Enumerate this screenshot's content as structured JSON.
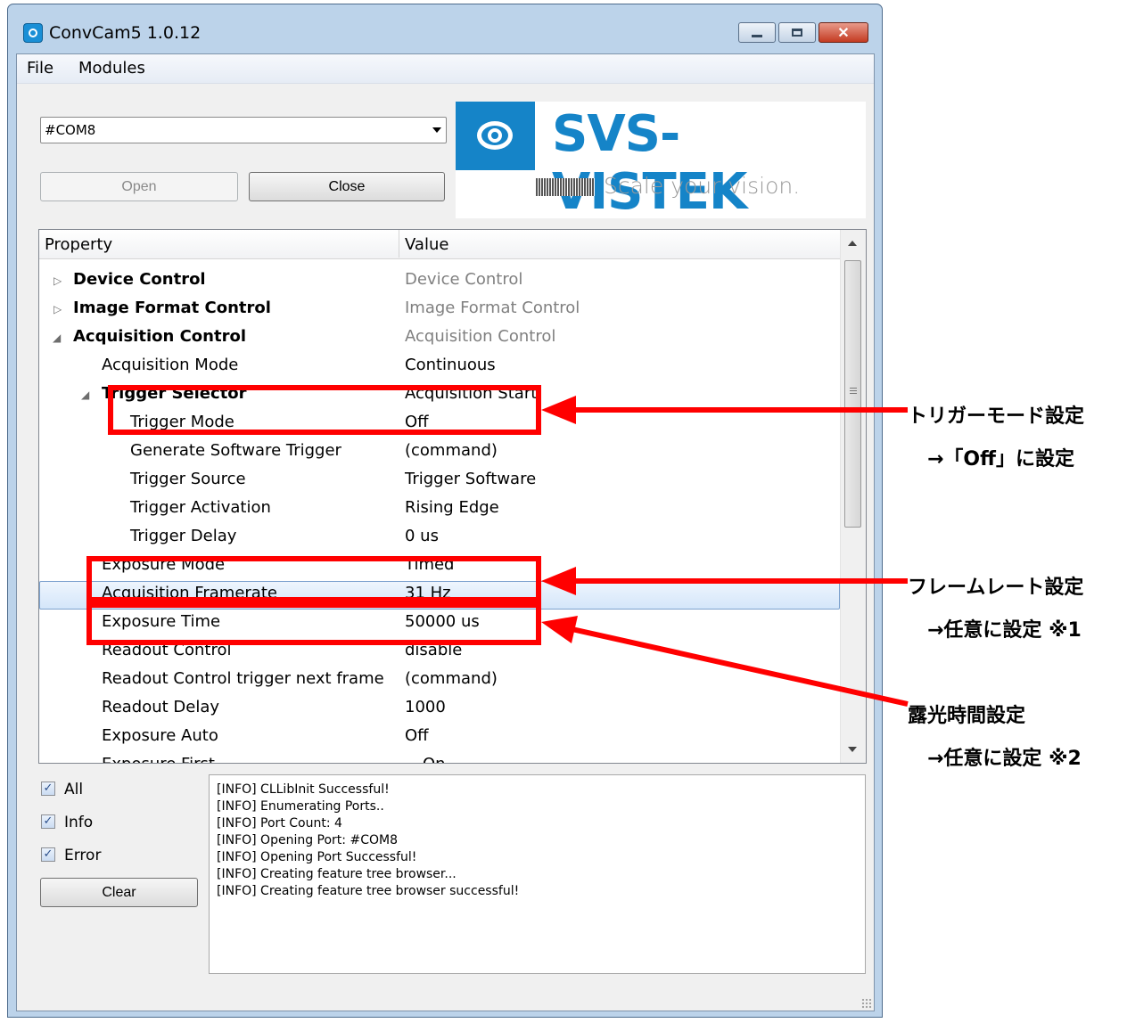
{
  "window": {
    "title": "ConvCam5 1.0.12",
    "close_glyph": "✕"
  },
  "menu": {
    "file": "File",
    "modules": "Modules"
  },
  "port": {
    "selected": "#COM8"
  },
  "buttons": {
    "open": "Open",
    "close": "Close",
    "clear": "Clear"
  },
  "logo": {
    "name": "SVS-VISTEK",
    "slogan": "Scale your vision.",
    "brand_color": "#1584c8"
  },
  "tree": {
    "headers": {
      "property": "Property",
      "value": "Value"
    },
    "rows": [
      {
        "name": "Device Control",
        "value": "Device Control"
      },
      {
        "name": "Image Format Control",
        "value": "Image Format Control"
      },
      {
        "name": "Acquisition Control",
        "value": "Acquisition Control"
      },
      {
        "name": "Acquisition Mode",
        "value": "Continuous"
      },
      {
        "name": "Trigger Selector",
        "value": "Acquisition Start"
      },
      {
        "name": "Trigger Mode",
        "value": "Off"
      },
      {
        "name": "Generate Software Trigger",
        "value": "(command)"
      },
      {
        "name": "Trigger Source",
        "value": "Trigger Software"
      },
      {
        "name": "Trigger Activation",
        "value": "Rising Edge"
      },
      {
        "name": "Trigger Delay",
        "value": "0 us"
      },
      {
        "name": "Exposure Mode",
        "value": "Timed"
      },
      {
        "name": "Acquisition Framerate",
        "value": "31 Hz"
      },
      {
        "name": "Exposure Time",
        "value": "50000 us"
      },
      {
        "name": "Readout Control",
        "value": "disable"
      },
      {
        "name": "Readout Control trigger next frame",
        "value": "(command)"
      },
      {
        "name": "Readout Delay",
        "value": "1000"
      },
      {
        "name": "Exposure Auto",
        "value": "Off"
      },
      {
        "name": "Exposure First",
        "value": "On"
      }
    ]
  },
  "filters": {
    "all": "All",
    "info": "Info",
    "error": "Error"
  },
  "log": [
    "[INFO] CLLibInit Successful!",
    "[INFO] Enumerating Ports..",
    "[INFO] Port Count: 4",
    "[INFO] Opening Port: #COM8",
    "[INFO] Opening Port Successful!",
    "[INFO] Creating feature tree browser...",
    "[INFO] Creating feature tree browser successful!"
  ],
  "annotations": {
    "trigger_title": "トリガーモード設定",
    "trigger_note": "→「Off」に設定",
    "framerate_title": "フレームレート設定",
    "framerate_note": "→任意に設定 ※1",
    "exposure_title": "露光時間設定",
    "exposure_note": "→任意に設定 ※2",
    "highlight_color": "#ff0000"
  }
}
